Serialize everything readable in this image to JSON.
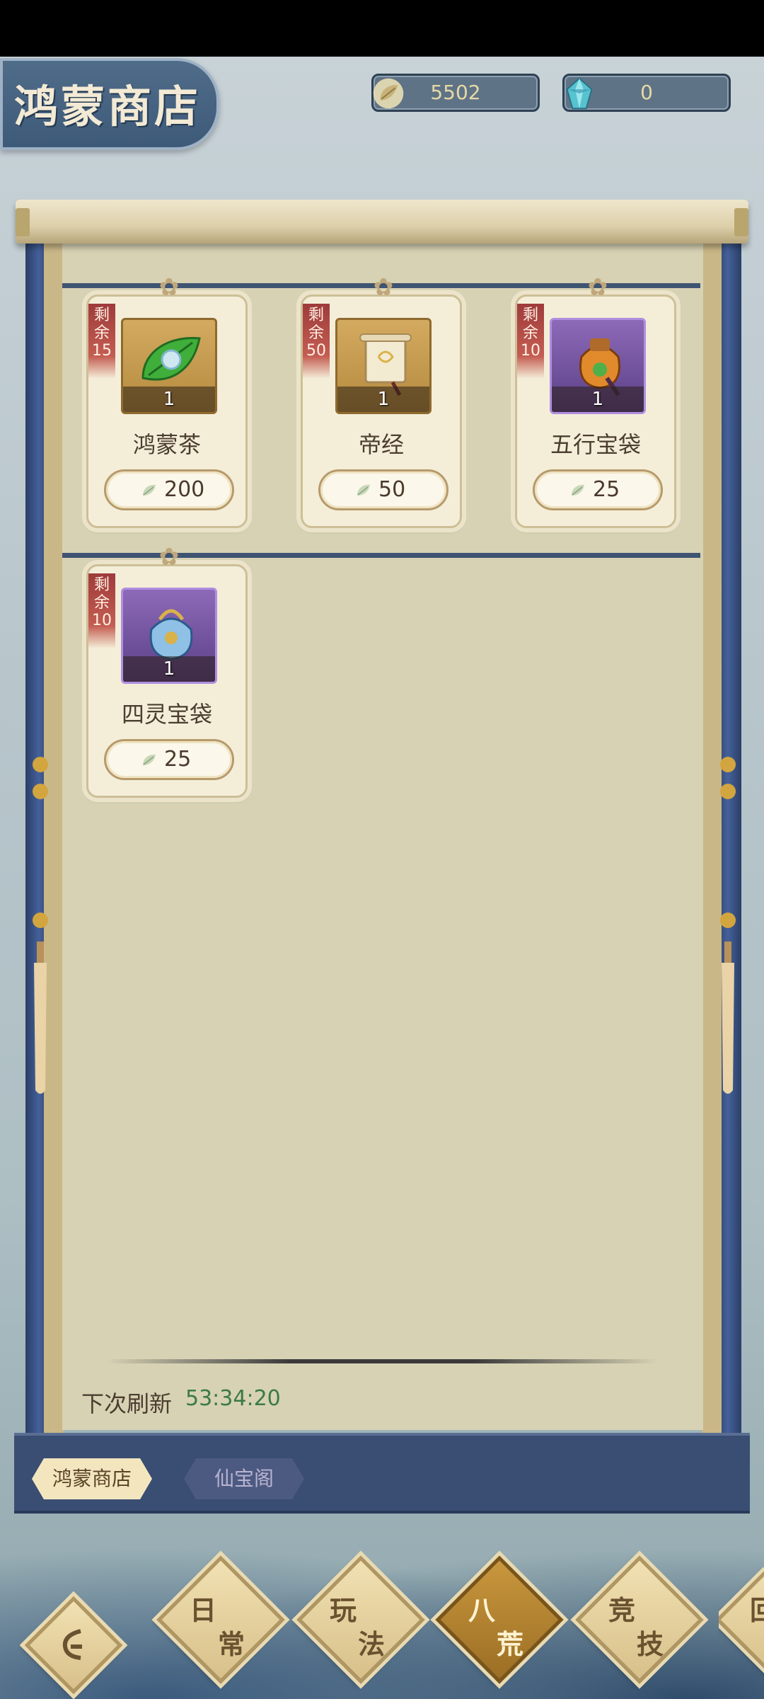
{
  "header": {
    "title": "鸿蒙商店",
    "currency_jade": "5502",
    "currency_gem": "0"
  },
  "items": [
    {
      "remain_label": [
        "剩",
        "余"
      ],
      "remain_count": "15",
      "qty": "1",
      "name": "鸿蒙茶",
      "price": "200",
      "frame": "gold",
      "icon": "tea-leaf-icon"
    },
    {
      "remain_label": [
        "剩",
        "余"
      ],
      "remain_count": "50",
      "qty": "1",
      "name": "帝经",
      "price": "50",
      "frame": "gold",
      "icon": "scroll-icon"
    },
    {
      "remain_label": [
        "剩",
        "余"
      ],
      "remain_count": "10",
      "qty": "1",
      "name": "五行宝袋",
      "price": "25",
      "frame": "purple",
      "icon": "five-elements-pouch-icon"
    },
    {
      "remain_label": [
        "剩",
        "余"
      ],
      "remain_count": "10",
      "qty": "1",
      "name": "四灵宝袋",
      "price": "25",
      "frame": "purple",
      "icon": "four-spirits-pouch-icon"
    }
  ],
  "refresh": {
    "label": "下次刷新",
    "time": "53:34:20"
  },
  "shop_tabs": [
    "鸿蒙商店",
    "仙宝阁"
  ],
  "bottom_nav": [
    {
      "c1": "日",
      "c2": "常"
    },
    {
      "c1": "玩",
      "c2": "法"
    },
    {
      "c1": "八",
      "c2": "荒"
    },
    {
      "c1": "竞",
      "c2": "技"
    },
    {
      "c1": "回",
      "c2": ""
    }
  ],
  "colors": {
    "scroll_rail": "#3f5372",
    "paper": "#d7d2b4",
    "remain_tag": "#9e3b3b",
    "timer": "#3b7a45"
  }
}
